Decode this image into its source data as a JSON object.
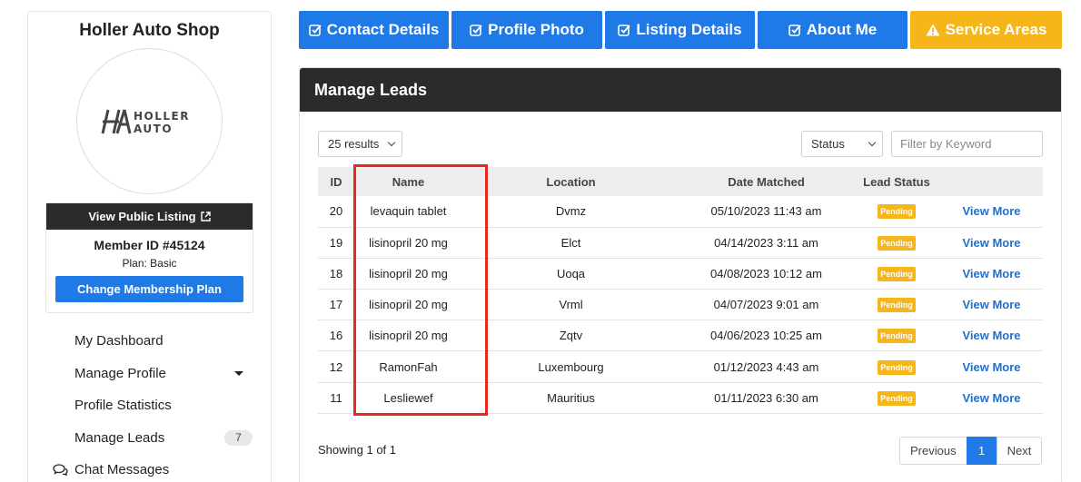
{
  "sidebar": {
    "shop_name": "Holler Auto Shop",
    "logo_text_1": "HOLLER",
    "logo_text_2": "AUTO",
    "view_listing": "View Public Listing",
    "member_id": "Member ID #45124",
    "plan": "Plan: Basic",
    "change_plan": "Change Membership Plan",
    "nav": [
      {
        "label": "My Dashboard"
      },
      {
        "label": "Manage Profile"
      },
      {
        "label": "Profile Statistics"
      },
      {
        "label": "Manage Leads",
        "badge": "7"
      },
      {
        "label": "Chat Messages"
      }
    ]
  },
  "tabs": [
    {
      "label": "Contact Details",
      "icon": "check-square-icon",
      "color": "#1f7ae8"
    },
    {
      "label": "Profile Photo",
      "icon": "check-square-icon",
      "color": "#1f7ae8"
    },
    {
      "label": "Listing Details",
      "icon": "check-square-icon",
      "color": "#1f7ae8"
    },
    {
      "label": "About Me",
      "icon": "check-square-icon",
      "color": "#1f7ae8"
    },
    {
      "label": "Service Areas",
      "icon": "warning-icon",
      "color": "#f6b519"
    }
  ],
  "panel": {
    "title": "Manage Leads",
    "results_select": "25 results",
    "status_select": "Status",
    "filter_placeholder": "Filter by Keyword",
    "columns": [
      "ID",
      "Name",
      "Location",
      "Date Matched",
      "Lead Status",
      ""
    ],
    "rows": [
      {
        "id": "20",
        "name": "levaquin tablet",
        "location": "Dvmz",
        "date": "05/10/2023 11:43 am",
        "status": "Pending",
        "action": "View More"
      },
      {
        "id": "19",
        "name": "lisinopril 20 mg",
        "location": "Elct",
        "date": "04/14/2023 3:11 am",
        "status": "Pending",
        "action": "View More"
      },
      {
        "id": "18",
        "name": "lisinopril 20 mg",
        "location": "Uoqa",
        "date": "04/08/2023 10:12 am",
        "status": "Pending",
        "action": "View More"
      },
      {
        "id": "17",
        "name": "lisinopril 20 mg",
        "location": "Vrml",
        "date": "04/07/2023 9:01 am",
        "status": "Pending",
        "action": "View More"
      },
      {
        "id": "16",
        "name": "lisinopril 20 mg",
        "location": "Zqtv",
        "date": "04/06/2023 10:25 am",
        "status": "Pending",
        "action": "View More"
      },
      {
        "id": "12",
        "name": "RamonFah",
        "location": "Luxembourg",
        "date": "01/12/2023 4:43 am",
        "status": "Pending",
        "action": "View More"
      },
      {
        "id": "11",
        "name": "Lesliewef",
        "location": "Mauritius",
        "date": "01/11/2023 6:30 am",
        "status": "Pending",
        "action": "View More"
      }
    ],
    "showing": "Showing 1 of 1",
    "pager": {
      "previous": "Previous",
      "page": "1",
      "next": "Next"
    }
  },
  "colors": {
    "accent": "#1f7ae8",
    "warning": "#f6b519",
    "dark": "#2b2b2b",
    "highlight": "#e8281e"
  }
}
